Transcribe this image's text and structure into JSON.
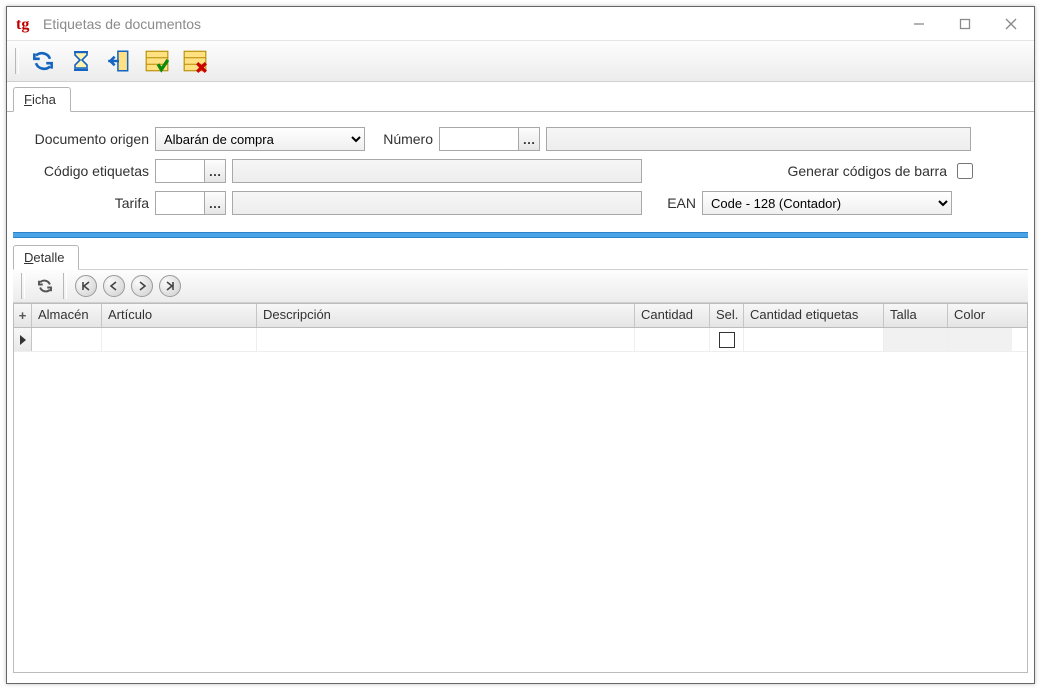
{
  "window": {
    "title": "Etiquetas de documentos",
    "app_icon_text": "tg"
  },
  "toolbar_icons": {
    "refresh": "refresh-icon",
    "hourglass": "hourglass-icon",
    "exit": "exit-icon",
    "select_all": "select-all-icon",
    "deselect_all": "deselect-all-icon"
  },
  "tabs": {
    "ficha": "Ficha",
    "ficha_accel": "F",
    "detalle": "Detalle",
    "detalle_accel": "D"
  },
  "form": {
    "documento_origen_label": "Documento origen",
    "documento_origen_value": "Albarán de compra",
    "numero_label": "Número",
    "numero_value": "",
    "numero_desc": "",
    "codigo_etiquetas_label": "Código etiquetas",
    "codigo_etiquetas_value": "",
    "codigo_etiquetas_desc": "",
    "generar_cb_label": "Generar códigos de barra",
    "generar_cb_checked": false,
    "tarifa_label": "Tarifa",
    "tarifa_value": "",
    "tarifa_desc": "",
    "ean_label": "EAN",
    "ean_value": "Code - 128 (Contador)",
    "lookup_glyph": "…"
  },
  "documento_origen_options": [
    "Albarán de compra"
  ],
  "ean_options": [
    "Code - 128 (Contador)"
  ],
  "grid": {
    "headers": {
      "almacen": "Almacén",
      "articulo": "Artículo",
      "descripcion": "Descripción",
      "cantidad": "Cantidad",
      "sel": "Sel.",
      "cantidad_etiquetas": "Cantidad etiquetas",
      "talla": "Talla",
      "color": "Color"
    },
    "rows": [
      {
        "almacen": "",
        "articulo": "",
        "descripcion": "",
        "cantidad": "",
        "sel": false,
        "cantidad_etiquetas": "",
        "talla": "",
        "color": ""
      }
    ]
  }
}
